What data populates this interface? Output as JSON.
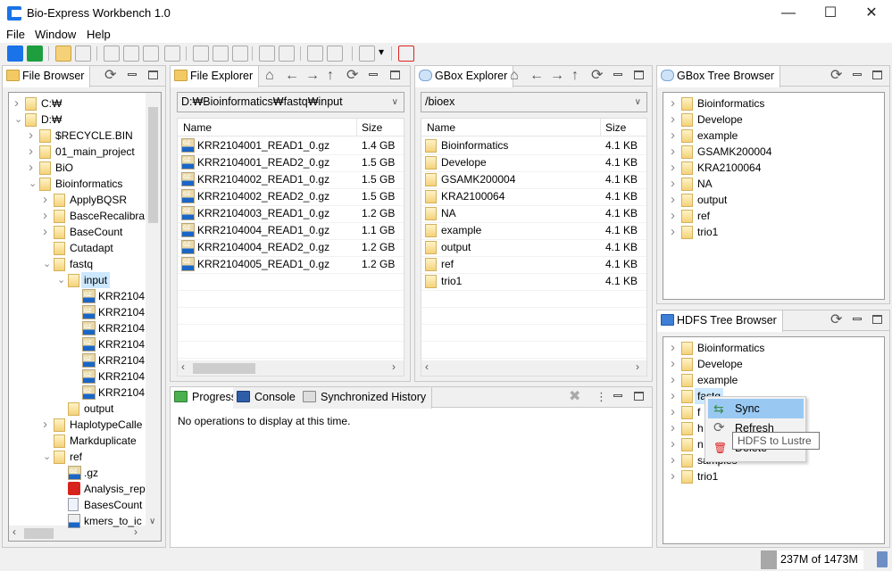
{
  "window": {
    "title": "Bio-Express Workbench 1.0",
    "controls": [
      "minimize",
      "maximize",
      "close"
    ]
  },
  "menu": [
    "File",
    "Window",
    "Help"
  ],
  "toolbar": {
    "icons": [
      "bio-express-icon",
      "gbox-icon",
      "new-folder-icon",
      "edit-folder-icon",
      "add-tree-icon",
      "edit-tree-icon",
      "share-icon",
      "export-tree-icon",
      "settings-window-icon",
      "check-window-icon",
      "sync-window-icon",
      "add-item-icon",
      "edit-item-icon",
      "add-item-2-icon",
      "edit-item-2-icon",
      "copy-icon",
      "delete-icon"
    ]
  },
  "file_browser": {
    "tab": "File Browser",
    "tree": [
      {
        "label": "C:₩",
        "lvl": 0,
        "state": "c",
        "icon": "folder"
      },
      {
        "label": "D:₩",
        "lvl": 0,
        "state": "e",
        "icon": "folder"
      },
      {
        "label": "$RECYCLE.BIN",
        "lvl": 1,
        "state": "c",
        "icon": "folder"
      },
      {
        "label": "01_main_project",
        "lvl": 1,
        "state": "c",
        "icon": "folder"
      },
      {
        "label": "BiO",
        "lvl": 1,
        "state": "c",
        "icon": "folder"
      },
      {
        "label": "Bioinformatics",
        "lvl": 1,
        "state": "e",
        "icon": "folder"
      },
      {
        "label": "ApplyBQSR",
        "lvl": 2,
        "state": "c",
        "icon": "folder"
      },
      {
        "label": "BasceRecalibra",
        "lvl": 2,
        "state": "c",
        "icon": "folder"
      },
      {
        "label": "BaseCount",
        "lvl": 2,
        "state": "c",
        "icon": "folder"
      },
      {
        "label": "Cutadapt",
        "lvl": 2,
        "state": "",
        "icon": "folder"
      },
      {
        "label": "fastq",
        "lvl": 2,
        "state": "e",
        "icon": "folder"
      },
      {
        "label": "input",
        "lvl": 3,
        "state": "e",
        "icon": "folder",
        "selected": true
      },
      {
        "label": "KRR2104",
        "lvl": 4,
        "state": "",
        "icon": "gz"
      },
      {
        "label": "KRR2104",
        "lvl": 4,
        "state": "",
        "icon": "gz"
      },
      {
        "label": "KRR2104",
        "lvl": 4,
        "state": "",
        "icon": "gz"
      },
      {
        "label": "KRR2104",
        "lvl": 4,
        "state": "",
        "icon": "gz"
      },
      {
        "label": "KRR2104",
        "lvl": 4,
        "state": "",
        "icon": "gz"
      },
      {
        "label": "KRR2104",
        "lvl": 4,
        "state": "",
        "icon": "gz"
      },
      {
        "label": "KRR2104",
        "lvl": 4,
        "state": "",
        "icon": "gz"
      },
      {
        "label": "output",
        "lvl": 3,
        "state": "",
        "icon": "folder"
      },
      {
        "label": "HaplotypeCalle",
        "lvl": 2,
        "state": "c",
        "icon": "folder"
      },
      {
        "label": "Markduplicate",
        "lvl": 2,
        "state": "",
        "icon": "folder"
      },
      {
        "label": "ref",
        "lvl": 2,
        "state": "e",
        "icon": "folder"
      },
      {
        "label": ".gz",
        "lvl": 3,
        "state": "",
        "icon": "gz"
      },
      {
        "label": "Analysis_rep",
        "lvl": 3,
        "state": "",
        "icon": "pdf"
      },
      {
        "label": "BasesCount",
        "lvl": 3,
        "state": "",
        "icon": "doc"
      },
      {
        "label": "kmers_to_ic",
        "lvl": 3,
        "state": "",
        "icon": "txt"
      }
    ]
  },
  "file_explorer": {
    "tab": "File Explorer",
    "path": "D:₩Bioinformatics₩fastq₩input",
    "columns": [
      "Name",
      "Size"
    ],
    "rows": [
      [
        "KRR2104001_READ1_0.gz",
        "1.4 GB"
      ],
      [
        "KRR2104001_READ2_0.gz",
        "1.5 GB"
      ],
      [
        "KRR2104002_READ1_0.gz",
        "1.5 GB"
      ],
      [
        "KRR2104002_READ2_0.gz",
        "1.5 GB"
      ],
      [
        "KRR2104003_READ1_0.gz",
        "1.2 GB"
      ],
      [
        "KRR2104004_READ1_0.gz",
        "1.1 GB"
      ],
      [
        "KRR2104004_READ2_0.gz",
        "1.2 GB"
      ],
      [
        "KRR2104005_READ1_0.gz",
        "1.2 GB"
      ]
    ]
  },
  "gbox_explorer": {
    "tab": "GBox Explorer",
    "path": "/bioex",
    "columns": [
      "Name",
      "Size"
    ],
    "rows": [
      [
        "Bioinformatics",
        "4.1 KB"
      ],
      [
        "Develope",
        "4.1 KB"
      ],
      [
        "GSAMK200004",
        "4.1 KB"
      ],
      [
        "KRA2100064",
        "4.1 KB"
      ],
      [
        "NA",
        "4.1 KB"
      ],
      [
        "example",
        "4.1 KB"
      ],
      [
        "output",
        "4.1 KB"
      ],
      [
        "ref",
        "4.1 KB"
      ],
      [
        "trio1",
        "4.1 KB"
      ]
    ]
  },
  "gbox_tree": {
    "tab": "GBox Tree Browser",
    "items": [
      "Bioinformatics",
      "Develope",
      "example",
      "GSAMK200004",
      "KRA2100064",
      "NA",
      "output",
      "ref",
      "trio1"
    ]
  },
  "hdfs_tree": {
    "tab": "HDFS Tree Browser",
    "items": [
      "Bioinformatics",
      "Develope",
      "example",
      "fastq",
      "f",
      "h",
      "n",
      "samples",
      "trio1"
    ]
  },
  "context_menu": {
    "items": [
      "Sync",
      "Refresh",
      "Delete"
    ],
    "highlighted": "Sync",
    "tooltip": "HDFS to Lustre"
  },
  "bottom": {
    "tabs": [
      "Progress",
      "Console",
      "Synchronized History"
    ],
    "active": "Progress",
    "message": "No operations to display at this time."
  },
  "status": {
    "heap": "237M of 1473M",
    "heap_used_fraction": 0.16
  },
  "colors": {
    "selection": "#cce8ff",
    "menu_highlight": "#99c9f3",
    "folder": "#f5d27a"
  }
}
